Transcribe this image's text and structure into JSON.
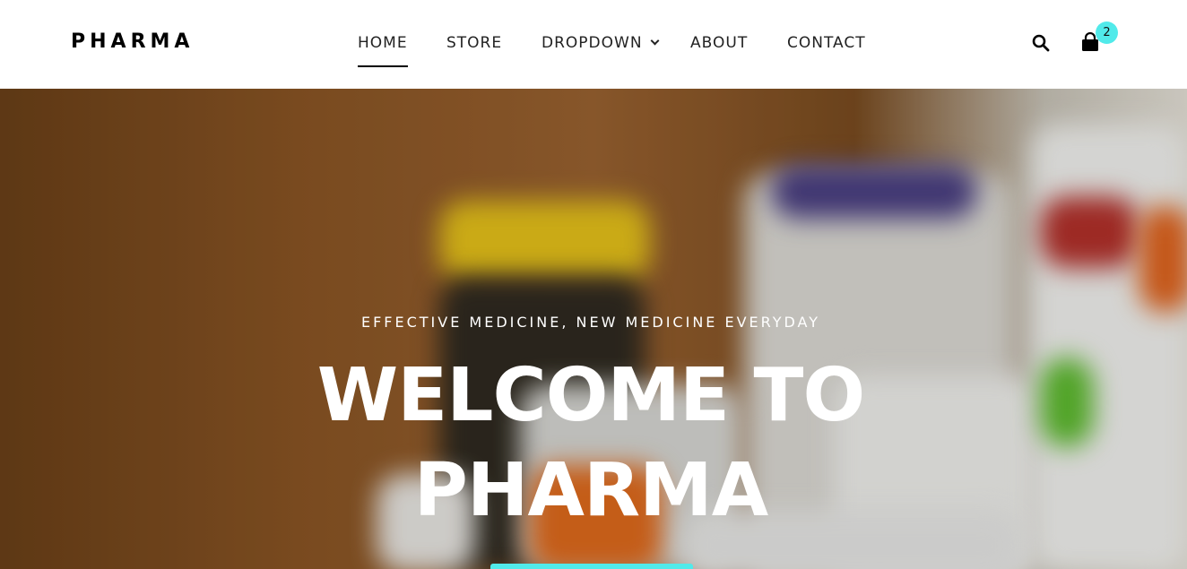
{
  "brand": {
    "name": "PHARMA"
  },
  "nav": {
    "home": "HOME",
    "store": "STORE",
    "dropdown": "DROPDOWN",
    "about": "ABOUT",
    "contact": "CONTACT"
  },
  "cart": {
    "count": "2"
  },
  "hero": {
    "subtitle": "EFFECTIVE MEDICINE, NEW MEDICINE EVERYDAY",
    "title_line1": "WELCOME TO",
    "title_line2": "PHARMA"
  },
  "icons": {
    "search": "search-icon",
    "cart": "shopping-bag-icon",
    "dropdown": "chevron-down-icon"
  },
  "colors": {
    "accent": "#51eaea",
    "text": "#000000",
    "hero_text": "#ffffff"
  }
}
